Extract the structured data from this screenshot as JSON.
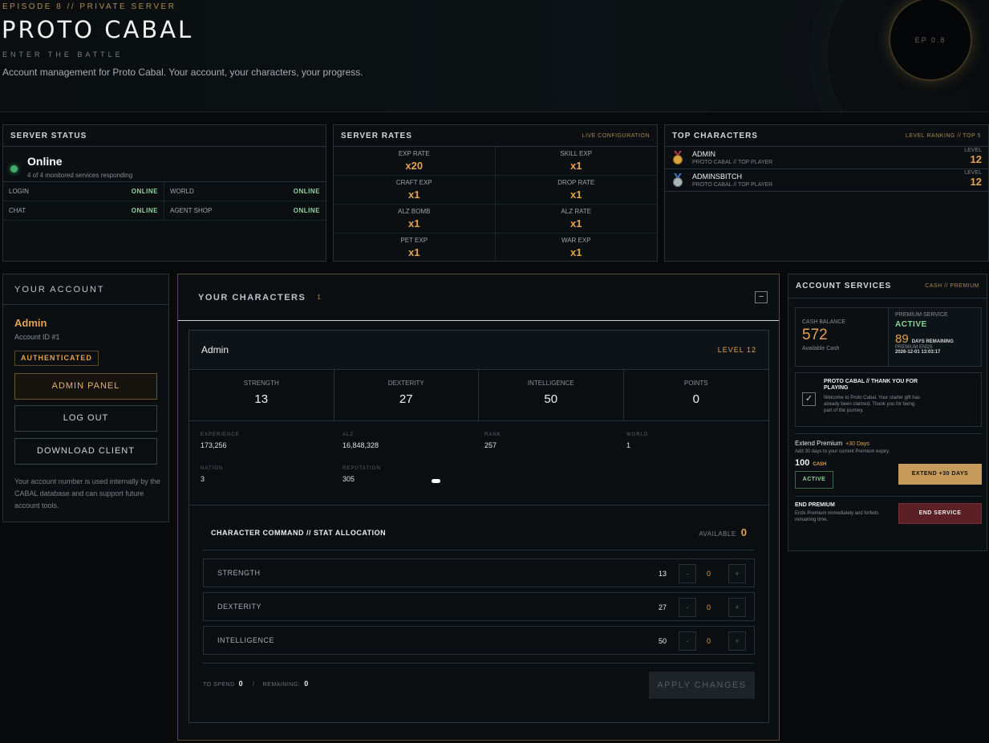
{
  "header": {
    "episode": "EPISODE 8 // PRIVATE SERVER",
    "title": "PROTO CABAL",
    "tagline": "ENTER THE BATTLE",
    "description": "Account management for Proto Cabal. Your account, your characters, your progress.",
    "orb_label": "EP 0.8"
  },
  "server_status": {
    "title": "SERVER STATUS",
    "status": "Online",
    "subtitle": "4 of 4 monitored services responding",
    "services": [
      {
        "name": "LOGIN",
        "value": "ONLINE"
      },
      {
        "name": "WORLD",
        "value": "ONLINE"
      },
      {
        "name": "CHAT",
        "value": "ONLINE"
      },
      {
        "name": "AGENT SHOP",
        "value": "ONLINE"
      }
    ]
  },
  "server_rates": {
    "title": "SERVER RATES",
    "tag": "LIVE CONFIGURATION",
    "rates": [
      {
        "name": "EXP RATE",
        "value": "x20"
      },
      {
        "name": "SKILL EXP",
        "value": "x1"
      },
      {
        "name": "CRAFT EXP",
        "value": "x1"
      },
      {
        "name": "DROP RATE",
        "value": "x1"
      },
      {
        "name": "ALZ BOMB",
        "value": "x1"
      },
      {
        "name": "ALZ RATE",
        "value": "x1"
      },
      {
        "name": "PET EXP",
        "value": "x1"
      },
      {
        "name": "WAR EXP",
        "value": "x1"
      }
    ]
  },
  "top_characters": {
    "title": "TOP CHARACTERS",
    "tag": "LEVEL RANKING // TOP 5",
    "entries": [
      {
        "name": "ADMIN",
        "sub": "PROTO CABAL // TOP PLAYER",
        "level_label": "LEVEL",
        "level": "12",
        "medal_color": "#d9a441"
      },
      {
        "name": "ADMINSBITCH",
        "sub": "PROTO CABAL // TOP PLAYER",
        "level_label": "LEVEL",
        "level": "12",
        "medal_color": "#aab4bb"
      }
    ]
  },
  "account": {
    "title": "YOUR ACCOUNT",
    "name": "Admin",
    "account_id": "Account ID #1",
    "badge": "AUTHENTICATED",
    "admin_panel": "ADMIN PANEL",
    "logout": "LOG OUT",
    "download": "DOWNLOAD CLIENT",
    "note": "Your account number is used internally by the CABAL database and can support future account tools."
  },
  "characters": {
    "title": "YOUR CHARACTERS",
    "count": "1",
    "collapse": "–",
    "character": {
      "name": "Admin",
      "level": "LEVEL 12",
      "stats": [
        {
          "name": "STRENGTH",
          "value": "13"
        },
        {
          "name": "DEXTERITY",
          "value": "27"
        },
        {
          "name": "INTELLIGENCE",
          "value": "50"
        },
        {
          "name": "POINTS",
          "value": "0"
        }
      ],
      "info": [
        {
          "label": "EXPERIENCE",
          "value": "173,256"
        },
        {
          "label": "ALZ",
          "value": "16,848,328"
        },
        {
          "label": "RANK",
          "value": "257"
        },
        {
          "label": "WORLD",
          "value": "1"
        },
        {
          "label": "NATION",
          "value": "3"
        },
        {
          "label": "REPUTATION",
          "value": "305"
        }
      ]
    },
    "allocation": {
      "title": "CHARACTER COMMAND // STAT ALLOCATION",
      "available_label": "AVAILABLE",
      "available_value": "0",
      "rows": [
        {
          "name": "STRENGTH",
          "current": "13",
          "delta": "0"
        },
        {
          "name": "DEXTERITY",
          "current": "27",
          "delta": "0"
        },
        {
          "name": "INTELLIGENCE",
          "current": "50",
          "delta": "0"
        }
      ],
      "minus": "-",
      "plus": "+",
      "to_spend_label": "TO SPEND",
      "to_spend": "0",
      "divider": "/",
      "remaining_label": "REMAINING:",
      "remaining": "0",
      "apply": "APPLY CHANGES"
    }
  },
  "services": {
    "title": "ACCOUNT SERVICES",
    "tag": "CASH // PREMIUM",
    "cash_label": "CASH BALANCE",
    "cash_value": "572",
    "cash_sub": "Available Cash",
    "premium_label": "PREMIUM SERVICE",
    "premium_status": "ACTIVE",
    "premium_days": "89",
    "premium_days_label": "DAYS REMAINING",
    "premium_ends_label": "PREMIUM ENDS",
    "premium_ends": "2026-12-01 13:03:17",
    "gift_check": "✓",
    "gift_title": "PROTO CABAL // THANK YOU FOR PLAYING",
    "gift_text": "Welcome to Proto Cabal. Your starter gift has already been claimed. Thank you for being part of the journey.",
    "extend_title": "Extend Premium",
    "extend_days": "+30 Days",
    "extend_sub": "Add 30 days to your current Premium expiry.",
    "extend_price": "100",
    "extend_currency": "CASH",
    "extend_badge": "ACTIVE",
    "extend_button": "EXTEND +30 DAYS",
    "end_title": "END PREMIUM",
    "end_text": "Ends Premium immediately and forfeits remaining time.",
    "end_button": "END SERVICE"
  }
}
